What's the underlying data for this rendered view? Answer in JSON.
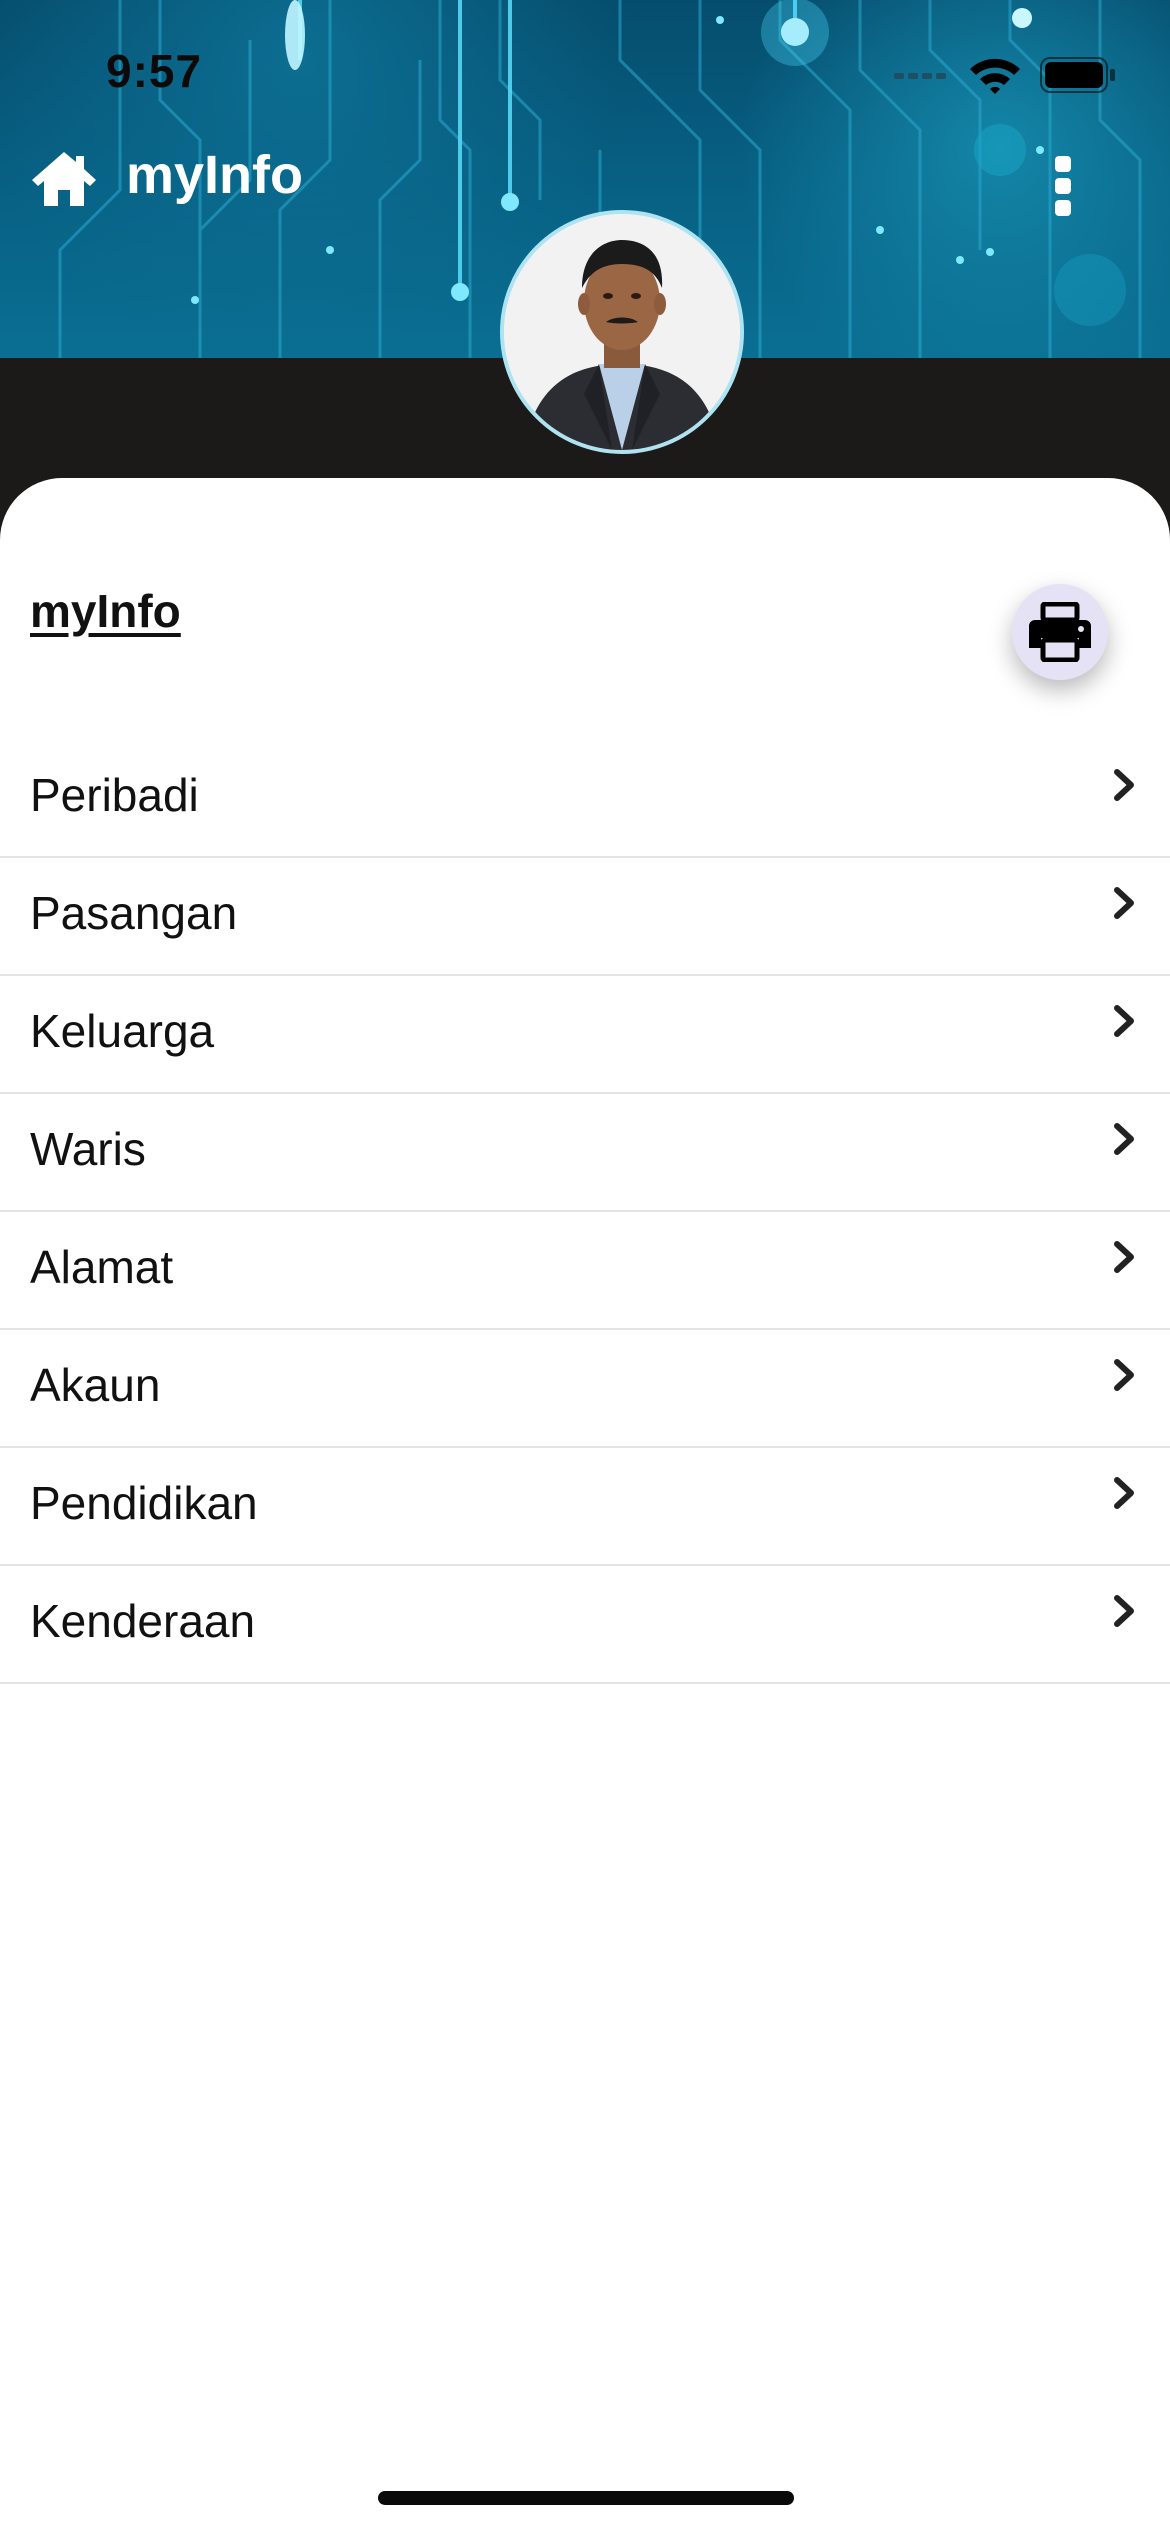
{
  "status_bar": {
    "time": "9:57",
    "icons": [
      "signal-icon",
      "wifi-icon",
      "battery-icon"
    ]
  },
  "app_bar": {
    "title": "myInfo",
    "home_icon": "home-icon",
    "more_icon": "more-vertical-icon"
  },
  "profile": {
    "avatar": "profile-photo"
  },
  "section": {
    "title": "myInfo",
    "print_icon": "printer-icon"
  },
  "menu": {
    "items": [
      {
        "label": "Peribadi"
      },
      {
        "label": "Pasangan"
      },
      {
        "label": "Keluarga"
      },
      {
        "label": "Waris"
      },
      {
        "label": "Alamat"
      },
      {
        "label": "Akaun"
      },
      {
        "label": "Pendidikan"
      },
      {
        "label": "Kenderaan"
      }
    ]
  },
  "colors": {
    "header_top": "#064d6d",
    "header_bottom": "#0a6f93",
    "dark_band": "#1c1a19",
    "sheet": "#ffffff",
    "print_button": "#e5e2f5",
    "divider": "#e4e4e4"
  }
}
